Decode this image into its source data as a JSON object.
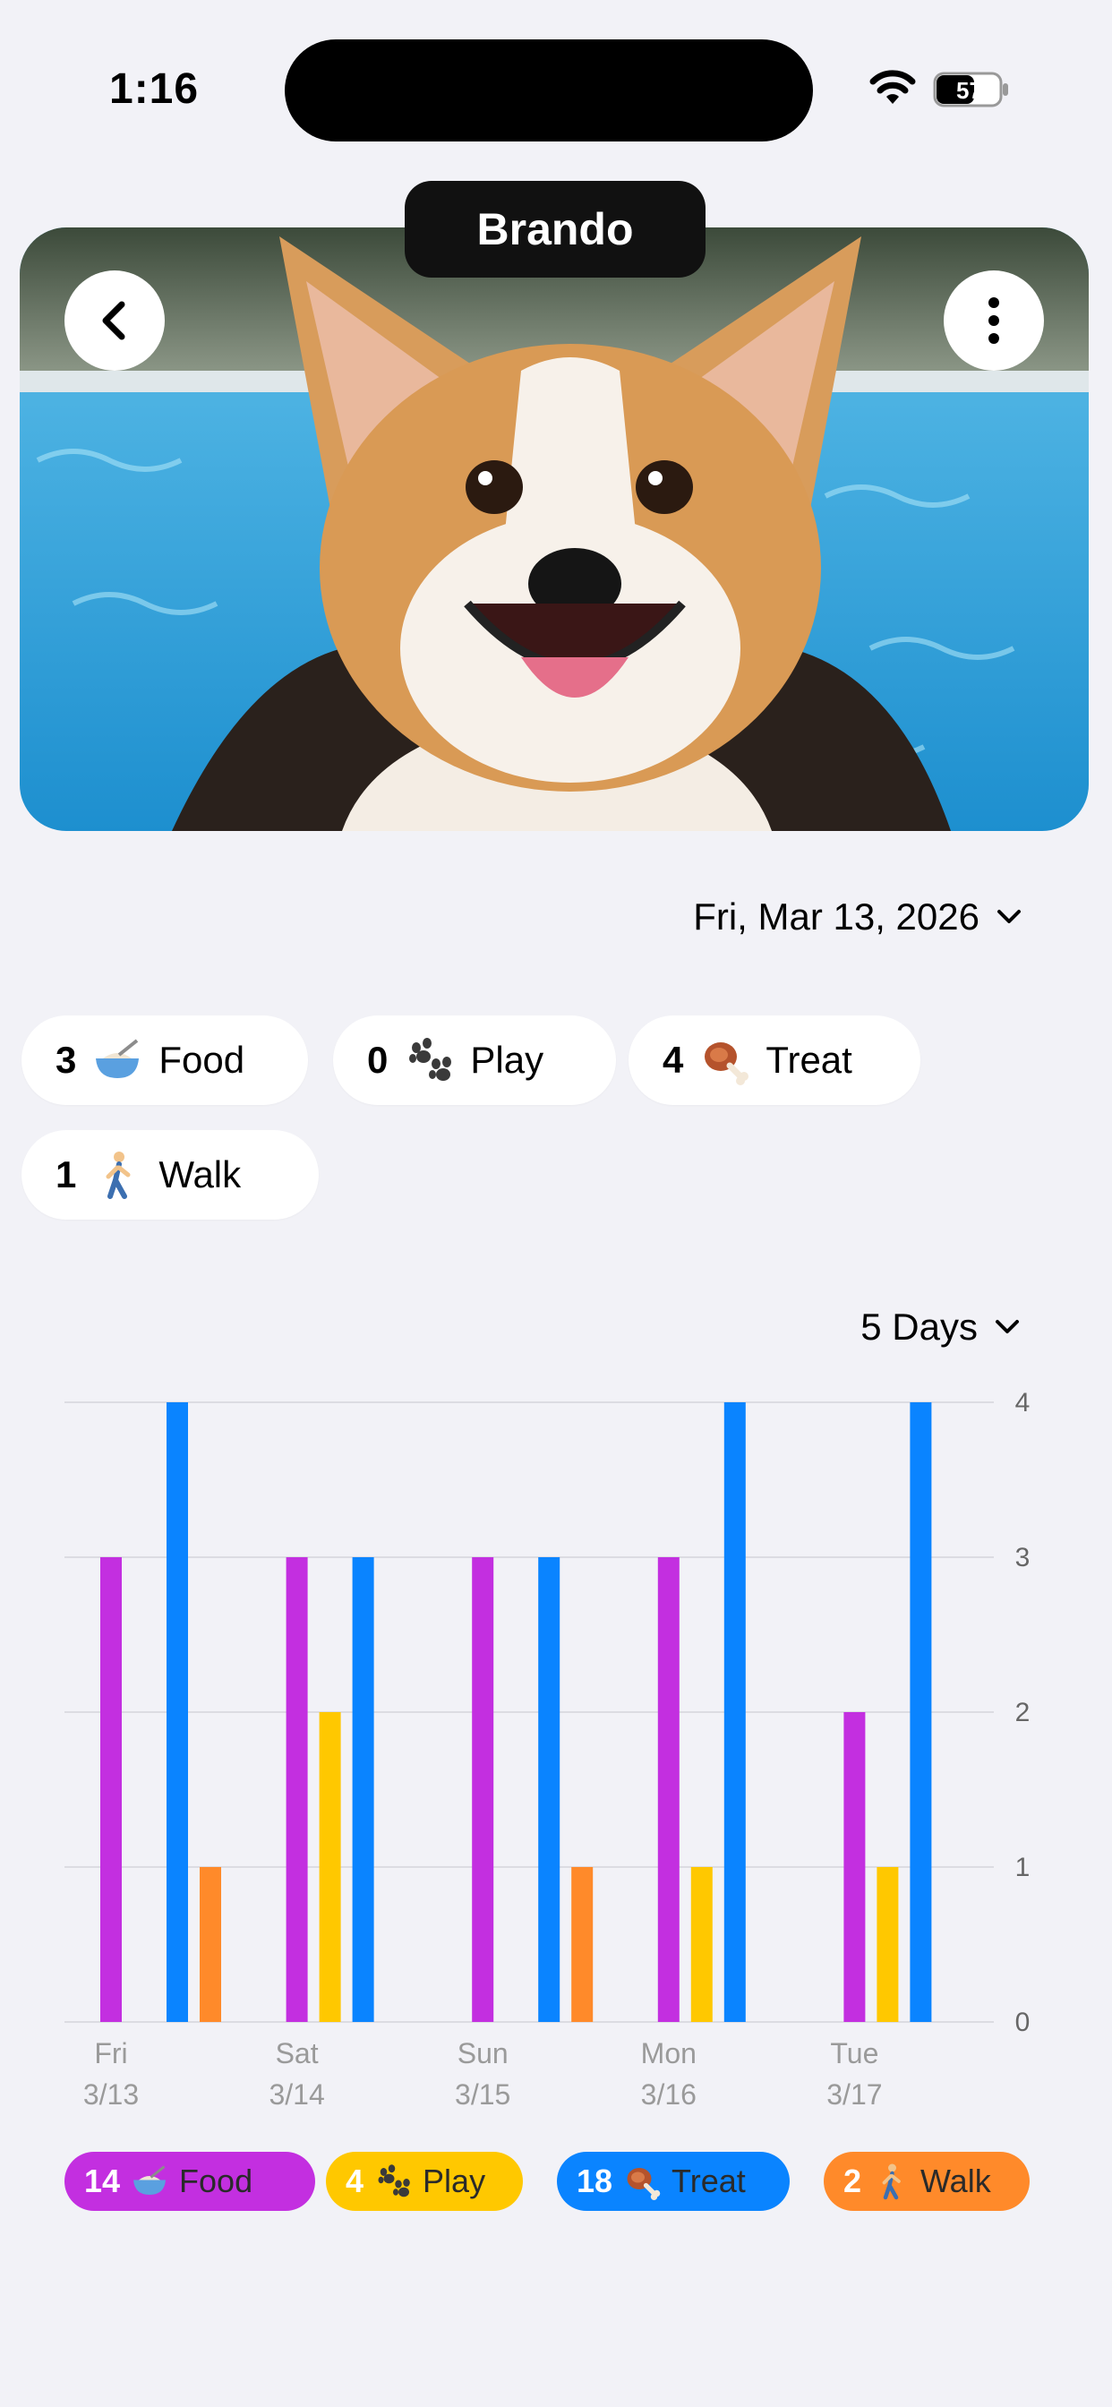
{
  "status_bar": {
    "time": "1:16",
    "battery": "57"
  },
  "pet": {
    "name": "Brando"
  },
  "date_selector": {
    "label": "Fri, Mar 13, 2026"
  },
  "today_counts": [
    {
      "count": "3",
      "label": "Food",
      "icon": "bowl-icon"
    },
    {
      "count": "0",
      "label": "Play",
      "icon": "paw-icon"
    },
    {
      "count": "4",
      "label": "Treat",
      "icon": "meat-icon"
    },
    {
      "count": "1",
      "label": "Walk",
      "icon": "walking-icon"
    }
  ],
  "range_selector": {
    "label": "5 Days"
  },
  "colors": {
    "food": "#c32fe0",
    "play": "#ffc800",
    "treat": "#0a84ff",
    "walk": "#ff8a2a"
  },
  "chart_data": {
    "type": "bar",
    "categories": [
      "Fri\n3/13",
      "Sat\n3/14",
      "Sun\n3/15",
      "Mon\n3/16",
      "Tue\n3/17"
    ],
    "series": [
      {
        "name": "Food",
        "values": [
          3,
          3,
          3,
          3,
          2
        ]
      },
      {
        "name": "Play",
        "values": [
          0,
          2,
          0,
          1,
          1
        ]
      },
      {
        "name": "Treat",
        "values": [
          4,
          3,
          3,
          4,
          4
        ]
      },
      {
        "name": "Walk",
        "values": [
          1,
          0,
          1,
          0,
          0
        ]
      }
    ],
    "x_ticks": [
      {
        "day": "Fri",
        "date": "3/13"
      },
      {
        "day": "Sat",
        "date": "3/14"
      },
      {
        "day": "Sun",
        "date": "3/15"
      },
      {
        "day": "Mon",
        "date": "3/16"
      },
      {
        "day": "Tue",
        "date": "3/17"
      }
    ],
    "y_ticks": [
      "0",
      "1",
      "2",
      "3",
      "4"
    ],
    "ylim": [
      0,
      4
    ],
    "grid": true,
    "y_axis_side": "right"
  },
  "legend": [
    {
      "total": "14",
      "label": "Food",
      "icon": "bowl-icon"
    },
    {
      "total": "4",
      "label": "Play",
      "icon": "paw-icon"
    },
    {
      "total": "18",
      "label": "Treat",
      "icon": "meat-icon"
    },
    {
      "total": "2",
      "label": "Walk",
      "icon": "walking-icon"
    }
  ]
}
